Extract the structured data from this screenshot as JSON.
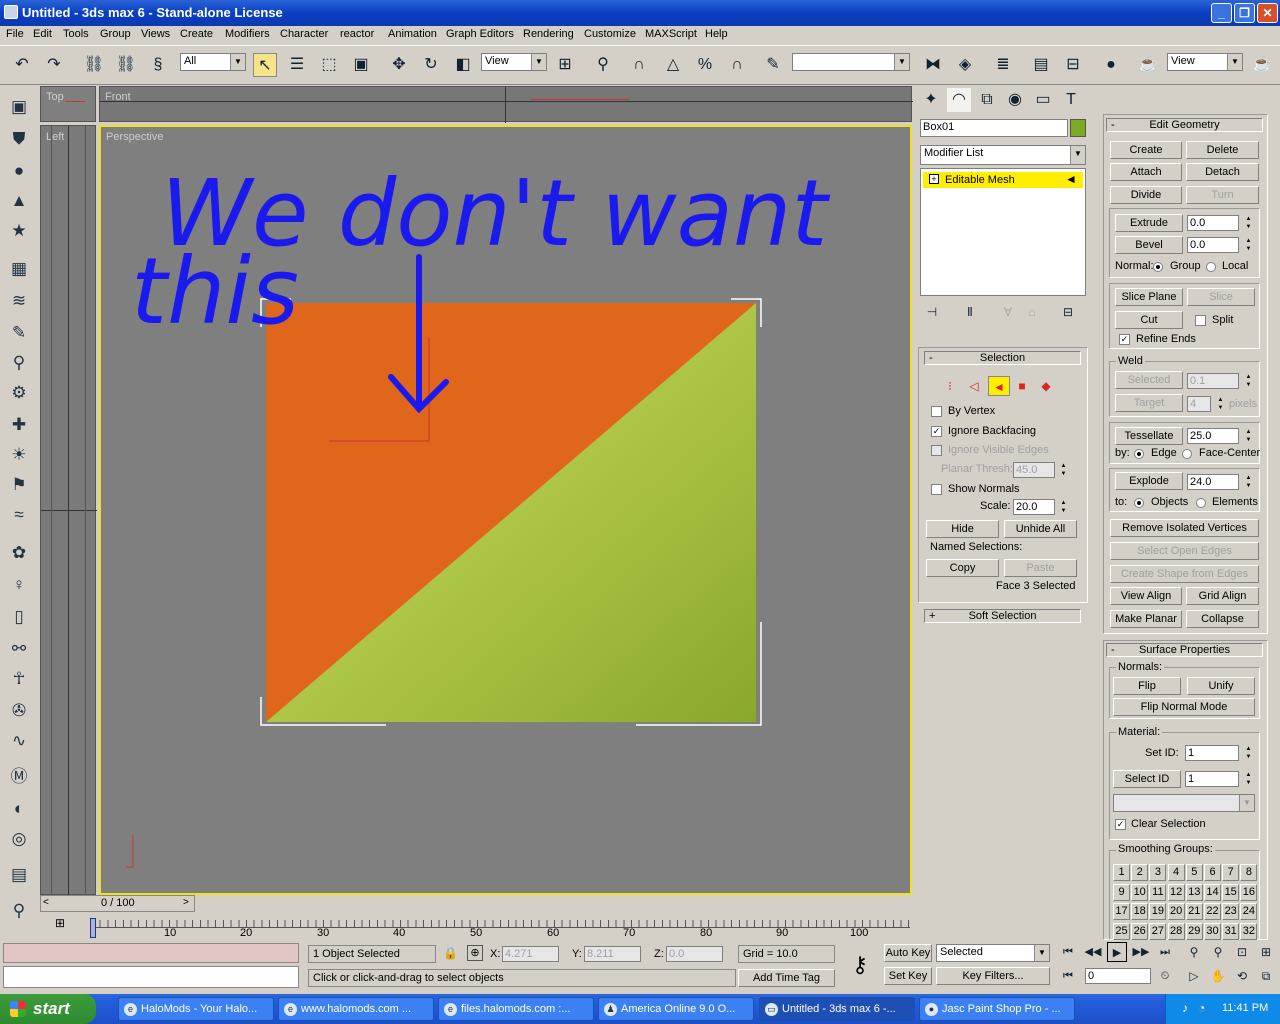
{
  "window": {
    "title": "Untitled - 3ds max 6 - Stand-alone License",
    "min": "_",
    "max": "❐",
    "close": "✕"
  },
  "menu": [
    "File",
    "Edit",
    "Tools",
    "Group",
    "Views",
    "Create",
    "Modifiers",
    "Character",
    "reactor",
    "Animation",
    "Graph Editors",
    "Rendering",
    "Customize",
    "MAXScript",
    "Help"
  ],
  "toolbar": {
    "filter": "All",
    "coord1": "View",
    "coord2": "View",
    "named_sel": ""
  },
  "viewports": {
    "top": "Top",
    "front": "Front",
    "left": "Left",
    "perspective": "Perspective"
  },
  "annotation": {
    "line1": "We don't want",
    "line2": "this"
  },
  "cmd": {
    "object_name": "Box01",
    "object_color": "#7caa23",
    "modifier_list": "Modifier List",
    "stack_item": "Editable Mesh"
  },
  "selection": {
    "title": "Selection",
    "pm": "-",
    "by_vertex": "By Vertex",
    "ignore_backfacing": "Ignore Backfacing",
    "ignore_visible_edges": "Ignore Visible Edges",
    "planar_thresh": "Planar Thresh:",
    "planar_val": "45.0",
    "show_normals": "Show Normals",
    "scale": "Scale:",
    "scale_val": "20.0",
    "hide": "Hide",
    "unhide_all": "Unhide All",
    "named_selections": "Named Selections:",
    "copy": "Copy",
    "paste": "Paste",
    "status": "Face 3 Selected",
    "soft_selection": "Soft Selection",
    "soft_pm": "+"
  },
  "edit_geometry": {
    "title": "Edit Geometry",
    "pm": "-",
    "create": "Create",
    "delete": "Delete",
    "attach": "Attach",
    "detach": "Detach",
    "divide": "Divide",
    "turn": "Turn",
    "extrude": "Extrude",
    "extrude_val": "0.0",
    "bevel": "Bevel",
    "bevel_val": "0.0",
    "normal": "Normal:",
    "group": "Group",
    "local": "Local",
    "slice_plane": "Slice Plane",
    "slice": "Slice",
    "cut": "Cut",
    "split": "Split",
    "refine_ends": "Refine Ends",
    "weld": "Weld",
    "selected": "Selected",
    "selected_val": "0.1",
    "target": "Target",
    "target_val": "4",
    "pixels": "pixels",
    "tessellate": "Tessellate",
    "tess_val": "25.0",
    "by": "by:",
    "edge": "Edge",
    "face_center": "Face-Center",
    "explode": "Explode",
    "explode_val": "24.0",
    "to": "to:",
    "objects": "Objects",
    "elements": "Elements",
    "remove_isolated": "Remove Isolated Vertices",
    "select_open_edges": "Select Open Edges",
    "create_shape": "Create Shape from Edges",
    "view_align": "View Align",
    "grid_align": "Grid Align",
    "make_planar": "Make Planar",
    "collapse": "Collapse"
  },
  "surface": {
    "title": "Surface Properties",
    "pm": "-",
    "normals": "Normals:",
    "flip": "Flip",
    "unify": "Unify",
    "flip_normal_mode": "Flip Normal Mode",
    "material": "Material:",
    "set_id": "Set ID:",
    "set_id_val": "1",
    "select_id": "Select ID",
    "select_id_val": "1",
    "clear_selection": "Clear Selection",
    "smoothing_groups": "Smoothing Groups:",
    "sg": [
      "1",
      "2",
      "3",
      "4",
      "5",
      "6",
      "7",
      "8",
      "9",
      "10",
      "11",
      "12",
      "13",
      "14",
      "15",
      "16",
      "17",
      "18",
      "19",
      "20",
      "21",
      "22",
      "23",
      "24",
      "25",
      "26",
      "27",
      "28",
      "29",
      "30",
      "31",
      "32"
    ]
  },
  "timeline": {
    "slider": "0 / 100",
    "ticks": [
      "10",
      "20",
      "30",
      "40",
      "50",
      "60",
      "70",
      "80",
      "90",
      "100"
    ]
  },
  "status": {
    "objects": "1 Object Selected",
    "x_lbl": "X:",
    "x": "4.271",
    "y_lbl": "Y:",
    "y": "8.211",
    "z_lbl": "Z:",
    "z": "0.0",
    "grid": "Grid = 10.0",
    "prompt": "Click or click-and-drag to select objects",
    "add_time_tag": "Add Time Tag",
    "auto_key": "Auto Key",
    "selected": "Selected",
    "set_key": "Set Key",
    "key_filters": "Key Filters...",
    "frame": "0"
  },
  "taskbar": {
    "start": "start",
    "clock": "11:41 PM",
    "items": [
      "HaloMods - Your Halo...",
      "www.halomods.com ...",
      "files.halomods.com :...",
      "America Online 9.0 O...",
      "Untitled - 3ds max 6 -...",
      "Jasc Paint Shop Pro - ..."
    ]
  }
}
